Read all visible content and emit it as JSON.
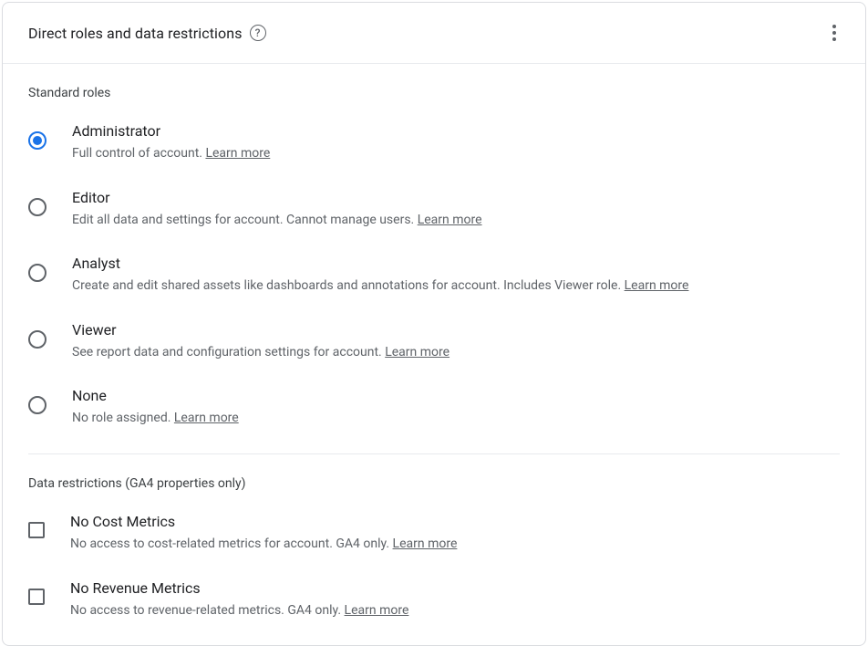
{
  "header": {
    "title": "Direct roles and data restrictions"
  },
  "sections": {
    "roles_title": "Standard roles",
    "restrictions_title": "Data restrictions (GA4 properties only)"
  },
  "roles": {
    "administrator": {
      "name": "Administrator",
      "desc": "Full control of account. ",
      "learn_more": "Learn more",
      "selected": true
    },
    "editor": {
      "name": "Editor",
      "desc": "Edit all data and settings for account. Cannot manage users. ",
      "learn_more": "Learn more",
      "selected": false
    },
    "analyst": {
      "name": "Analyst",
      "desc": "Create and edit shared assets like dashboards and annotations for account. Includes Viewer role. ",
      "learn_more": "Learn more",
      "selected": false
    },
    "viewer": {
      "name": "Viewer",
      "desc": "See report data and configuration settings for account. ",
      "learn_more": "Learn more",
      "selected": false
    },
    "none": {
      "name": "None",
      "desc": "No role assigned. ",
      "learn_more": "Learn more",
      "selected": false
    }
  },
  "restrictions": {
    "no_cost": {
      "name": "No Cost Metrics",
      "desc": "No access to cost-related metrics for account. GA4 only. ",
      "learn_more": "Learn more",
      "checked": false
    },
    "no_revenue": {
      "name": "No Revenue Metrics",
      "desc": "No access to revenue-related metrics. GA4 only. ",
      "learn_more": "Learn more",
      "checked": false
    }
  }
}
